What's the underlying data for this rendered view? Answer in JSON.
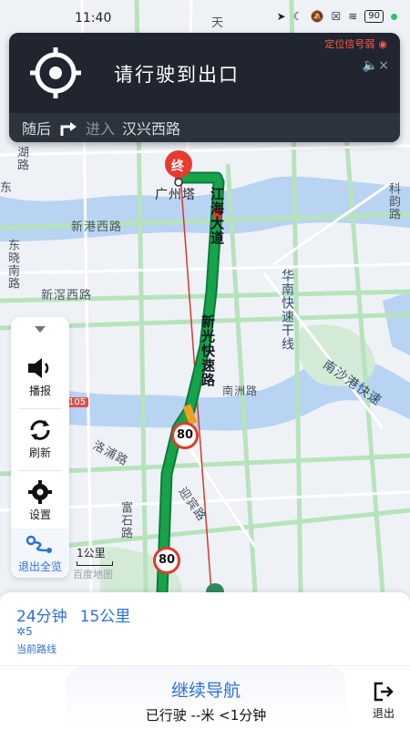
{
  "status_bar": {
    "time": "11:40",
    "battery": "90"
  },
  "nav": {
    "instruction": "请行驶到出口",
    "signal_warning": "定位信号弱",
    "then_label": "随后",
    "enter_label": "进入",
    "next_road": "汉兴西路"
  },
  "map": {
    "dest_badge": "终",
    "poi": "广州塔",
    "roads": {
      "jianghai": "江海大道",
      "xinguang": "新光快速路",
      "xingang": "新港西路",
      "xinjiao": "新滘西路",
      "huanan": "华南快速干线",
      "nanzhou": "南洲路",
      "nansha": "南沙港快速",
      "luopu": "洛浦路",
      "fushi": "富石路",
      "yingbin": "迎宾路",
      "dongxiao": "东晓南路",
      "hu": "湖路",
      "kejiyun": "科韵路",
      "tian": "天",
      "dong": "东"
    },
    "speed_limits": [
      "80",
      "80"
    ],
    "highway_tag": "105",
    "attribution": "百度地图"
  },
  "toolbar": {
    "broadcast": "播报",
    "refresh": "刷新",
    "settings": "设置",
    "exit_overview": "退出全览"
  },
  "scale": "1公里",
  "route": {
    "time": "24分钟",
    "distance": "15公里",
    "lights": "5",
    "current_route": "当前路线"
  },
  "bottom": {
    "continue": "继续导航",
    "traveled_label": "已行驶",
    "traveled": "--米",
    "elapsed": "<1分钟",
    "exit": "退出"
  },
  "colors": {
    "accent": "#2f6fe0",
    "route_green": "#16a34a",
    "panel_dark": "#20252f"
  }
}
